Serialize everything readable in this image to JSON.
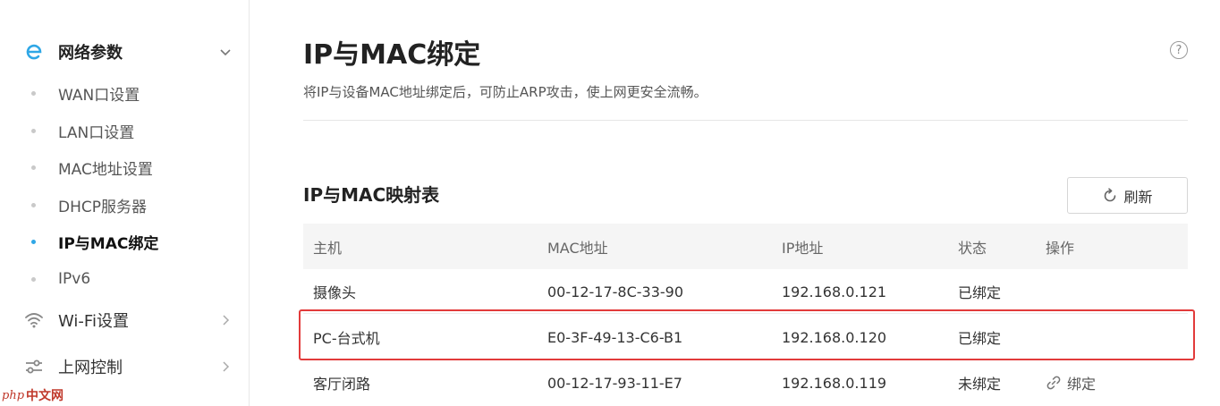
{
  "sidebar": {
    "groups": [
      {
        "label": "网络参数",
        "icon": "network-e-icon",
        "expanded": true
      },
      {
        "label": "Wi-Fi设置",
        "icon": "wifi-icon"
      },
      {
        "label": "上网控制",
        "icon": "sliders-icon"
      }
    ],
    "items": [
      {
        "label": "WAN口设置"
      },
      {
        "label": "LAN口设置"
      },
      {
        "label": "MAC地址设置"
      },
      {
        "label": "DHCP服务器"
      },
      {
        "label": "IP与MAC绑定",
        "active": true
      },
      {
        "label": "IPv6"
      }
    ],
    "accent_color": "#2fa7e6"
  },
  "watermark": {
    "php": "php",
    "cn": "中文网"
  },
  "main": {
    "title": "IP与MAC绑定",
    "description": "将IP与设备MAC地址绑定后，可防止ARP攻击，使上网更安全流畅。",
    "section_title": "IP与MAC映射表",
    "refresh_label": "刷新",
    "table": {
      "headers": [
        "主机",
        "MAC地址",
        "IP地址",
        "状态",
        "操作"
      ],
      "rows": [
        {
          "host": "摄像头",
          "mac": "00-12-17-8C-33-90",
          "ip": "192.168.0.121",
          "status": "已绑定",
          "action": ""
        },
        {
          "host": "PC-台式机",
          "mac": "E0-3F-49-13-C6-B1",
          "ip": "192.168.0.120",
          "status": "已绑定",
          "action": "",
          "highlighted": true
        },
        {
          "host": "客厅闭路",
          "mac": "00-12-17-93-11-E7",
          "ip": "192.168.0.119",
          "status": "未绑定",
          "action": "绑定"
        }
      ]
    },
    "highlight_color": "#e23b3b"
  }
}
